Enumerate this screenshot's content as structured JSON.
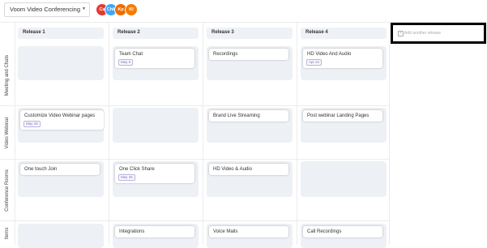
{
  "product": {
    "selected": "Voom Video Conferencing"
  },
  "avatars": [
    {
      "initials": "Ca",
      "color": "#e53935"
    },
    {
      "initials": "Chk",
      "color": "#42a5f5"
    },
    {
      "initials": "Kp",
      "color": "#ef6c00"
    },
    {
      "initials": "Kl",
      "color": "#f57c00"
    }
  ],
  "releases": [
    {
      "label": "Release 1"
    },
    {
      "label": "Release 2"
    },
    {
      "label": "Release 3"
    },
    {
      "label": "Release 4"
    }
  ],
  "add_release": {
    "label": "Add another release"
  },
  "rows": [
    {
      "label": "Meeting and Chats"
    },
    {
      "label": "Video Webinar"
    },
    {
      "label": "Conference Rooms"
    },
    {
      "label": "Items"
    }
  ],
  "cells": [
    [
      null,
      {
        "title": "Team Chat",
        "date": "May 5"
      },
      {
        "title": "Recordings"
      },
      {
        "title": "HD Video And Audio",
        "date": "Apr 21"
      }
    ],
    [
      {
        "title": "Customize Video Webinar pages",
        "date": "May 28"
      },
      null,
      {
        "title": "Brand Live Streaming"
      },
      {
        "title": "Post webinar Landing Pages"
      }
    ],
    [
      {
        "title": "One touch Join"
      },
      {
        "title": "One Click Share",
        "date": "May 26"
      },
      {
        "title": "HD Video & Audio"
      },
      null
    ],
    [
      null,
      {
        "title": "Integrations"
      },
      {
        "title": "Voice Mails"
      },
      {
        "title": "Call Recordings"
      }
    ]
  ]
}
